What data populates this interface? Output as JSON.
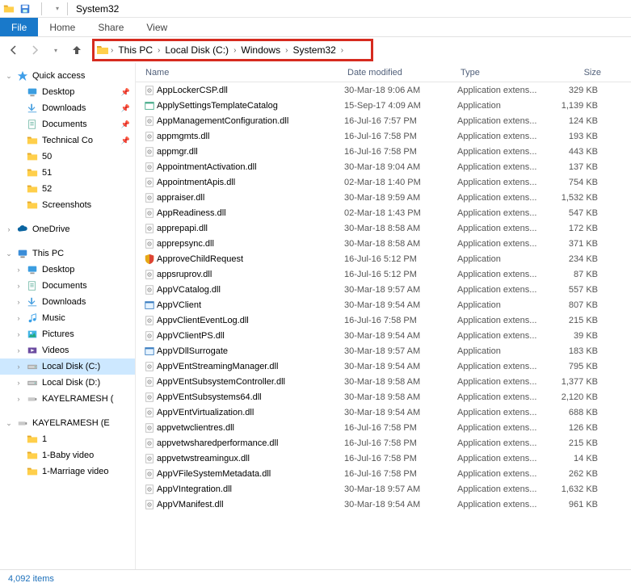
{
  "window": {
    "title": "System32"
  },
  "tabs": {
    "file": "File",
    "home": "Home",
    "share": "Share",
    "view": "View"
  },
  "breadcrumb": [
    "This PC",
    "Local Disk (C:)",
    "Windows",
    "System32"
  ],
  "columns": {
    "name": "Name",
    "date": "Date modified",
    "type": "Type",
    "size": "Size"
  },
  "tree": {
    "quick_access": "Quick access",
    "qa_items": [
      {
        "label": "Desktop",
        "icon": "desktop",
        "pinned": true
      },
      {
        "label": "Downloads",
        "icon": "downloads",
        "pinned": true
      },
      {
        "label": "Documents",
        "icon": "documents",
        "pinned": true
      },
      {
        "label": "Technical Co",
        "icon": "folder",
        "pinned": true
      },
      {
        "label": "50",
        "icon": "folder",
        "pinned": false
      },
      {
        "label": "51",
        "icon": "folder",
        "pinned": false
      },
      {
        "label": "52",
        "icon": "folder",
        "pinned": false
      },
      {
        "label": "Screenshots",
        "icon": "folder",
        "pinned": false
      }
    ],
    "onedrive": "OneDrive",
    "thispc": "This PC",
    "pc_items": [
      {
        "label": "Desktop",
        "icon": "desktop"
      },
      {
        "label": "Documents",
        "icon": "documents"
      },
      {
        "label": "Downloads",
        "icon": "downloads"
      },
      {
        "label": "Music",
        "icon": "music"
      },
      {
        "label": "Pictures",
        "icon": "pictures"
      },
      {
        "label": "Videos",
        "icon": "videos"
      },
      {
        "label": "Local Disk (C:)",
        "icon": "drive",
        "selected": true
      },
      {
        "label": "Local Disk (D:)",
        "icon": "drive"
      },
      {
        "label": "KAYELRAMESH (",
        "icon": "usb"
      }
    ],
    "ext_drive": "KAYELRAMESH (E",
    "ext_items": [
      {
        "label": "1",
        "icon": "folder"
      },
      {
        "label": "1-Baby video",
        "icon": "folder"
      },
      {
        "label": "1-Marriage video",
        "icon": "folder"
      }
    ]
  },
  "files": [
    {
      "name": "AppLockerCSP.dll",
      "date": "30-Mar-18 9:06 AM",
      "type": "Application extens...",
      "size": "329 KB",
      "icon": "dll"
    },
    {
      "name": "ApplySettingsTemplateCatalog",
      "date": "15-Sep-17 4:09 AM",
      "type": "Application",
      "size": "1,139 KB",
      "icon": "exe"
    },
    {
      "name": "AppManagementConfiguration.dll",
      "date": "16-Jul-16 7:57 PM",
      "type": "Application extens...",
      "size": "124 KB",
      "icon": "dll"
    },
    {
      "name": "appmgmts.dll",
      "date": "16-Jul-16 7:58 PM",
      "type": "Application extens...",
      "size": "193 KB",
      "icon": "dll"
    },
    {
      "name": "appmgr.dll",
      "date": "16-Jul-16 7:58 PM",
      "type": "Application extens...",
      "size": "443 KB",
      "icon": "dll"
    },
    {
      "name": "AppointmentActivation.dll",
      "date": "30-Mar-18 9:04 AM",
      "type": "Application extens...",
      "size": "137 KB",
      "icon": "dll"
    },
    {
      "name": "AppointmentApis.dll",
      "date": "02-Mar-18 1:40 PM",
      "type": "Application extens...",
      "size": "754 KB",
      "icon": "dll"
    },
    {
      "name": "appraiser.dll",
      "date": "30-Mar-18 9:59 AM",
      "type": "Application extens...",
      "size": "1,532 KB",
      "icon": "dll"
    },
    {
      "name": "AppReadiness.dll",
      "date": "02-Mar-18 1:43 PM",
      "type": "Application extens...",
      "size": "547 KB",
      "icon": "dll"
    },
    {
      "name": "apprepapi.dll",
      "date": "30-Mar-18 8:58 AM",
      "type": "Application extens...",
      "size": "172 KB",
      "icon": "dll"
    },
    {
      "name": "apprepsync.dll",
      "date": "30-Mar-18 8:58 AM",
      "type": "Application extens...",
      "size": "371 KB",
      "icon": "dll"
    },
    {
      "name": "ApproveChildRequest",
      "date": "16-Jul-16 5:12 PM",
      "type": "Application",
      "size": "234 KB",
      "icon": "shield"
    },
    {
      "name": "appsruprov.dll",
      "date": "16-Jul-16 5:12 PM",
      "type": "Application extens...",
      "size": "87 KB",
      "icon": "dll"
    },
    {
      "name": "AppVCatalog.dll",
      "date": "30-Mar-18 9:57 AM",
      "type": "Application extens...",
      "size": "557 KB",
      "icon": "dll"
    },
    {
      "name": "AppVClient",
      "date": "30-Mar-18 9:54 AM",
      "type": "Application",
      "size": "807 KB",
      "icon": "window"
    },
    {
      "name": "AppvClientEventLog.dll",
      "date": "16-Jul-16 7:58 PM",
      "type": "Application extens...",
      "size": "215 KB",
      "icon": "dll"
    },
    {
      "name": "AppVClientPS.dll",
      "date": "30-Mar-18 9:54 AM",
      "type": "Application extens...",
      "size": "39 KB",
      "icon": "dll"
    },
    {
      "name": "AppVDllSurrogate",
      "date": "30-Mar-18 9:57 AM",
      "type": "Application",
      "size": "183 KB",
      "icon": "window"
    },
    {
      "name": "AppVEntStreamingManager.dll",
      "date": "30-Mar-18 9:54 AM",
      "type": "Application extens...",
      "size": "795 KB",
      "icon": "dll"
    },
    {
      "name": "AppVEntSubsystemController.dll",
      "date": "30-Mar-18 9:58 AM",
      "type": "Application extens...",
      "size": "1,377 KB",
      "icon": "dll"
    },
    {
      "name": "AppVEntSubsystems64.dll",
      "date": "30-Mar-18 9:58 AM",
      "type": "Application extens...",
      "size": "2,120 KB",
      "icon": "dll"
    },
    {
      "name": "AppVEntVirtualization.dll",
      "date": "30-Mar-18 9:54 AM",
      "type": "Application extens...",
      "size": "688 KB",
      "icon": "dll"
    },
    {
      "name": "appvetwclientres.dll",
      "date": "16-Jul-16 7:58 PM",
      "type": "Application extens...",
      "size": "126 KB",
      "icon": "dll"
    },
    {
      "name": "appvetwsharedperformance.dll",
      "date": "16-Jul-16 7:58 PM",
      "type": "Application extens...",
      "size": "215 KB",
      "icon": "dll"
    },
    {
      "name": "appvetwstreamingux.dll",
      "date": "16-Jul-16 7:58 PM",
      "type": "Application extens...",
      "size": "14 KB",
      "icon": "dll"
    },
    {
      "name": "AppVFileSystemMetadata.dll",
      "date": "16-Jul-16 7:58 PM",
      "type": "Application extens...",
      "size": "262 KB",
      "icon": "dll"
    },
    {
      "name": "AppVIntegration.dll",
      "date": "30-Mar-18 9:57 AM",
      "type": "Application extens...",
      "size": "1,632 KB",
      "icon": "dll"
    },
    {
      "name": "AppVManifest.dll",
      "date": "30-Mar-18 9:54 AM",
      "type": "Application extens...",
      "size": "961 KB",
      "icon": "dll"
    }
  ],
  "status": "4,092 items"
}
